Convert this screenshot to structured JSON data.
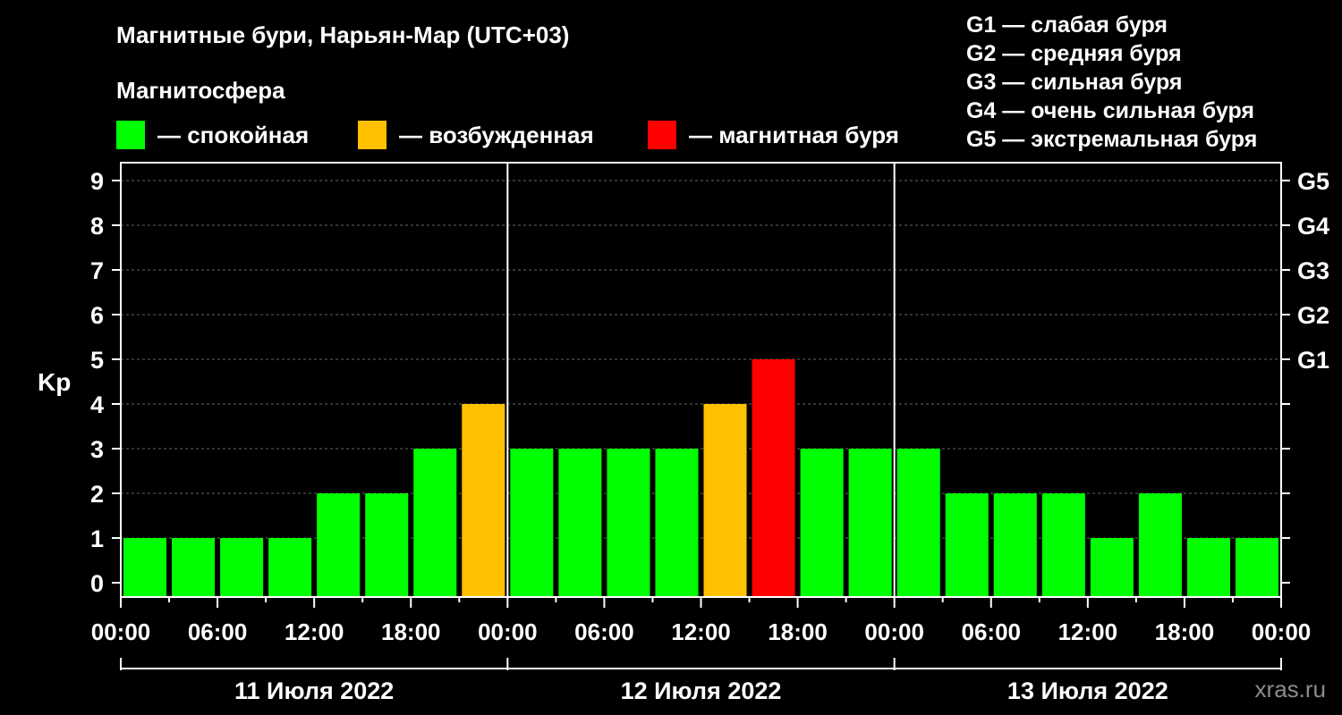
{
  "title": "Магнитные бури, Нарьян-Мар (UTC+03)",
  "legend": {
    "heading": "Магнитосфера",
    "items": [
      {
        "label": "— спокойная",
        "color": "#00ff00"
      },
      {
        "label": "— возбужденная",
        "color": "#ffc000"
      },
      {
        "label": "— магнитная буря",
        "color": "#ff0000"
      }
    ]
  },
  "storm_levels": [
    "G1 — слабая буря",
    "G2 — средняя буря",
    "G3 — сильная буря",
    "G4 — очень сильная буря",
    "G5 — экстремальная буря"
  ],
  "watermark": "xras.ru",
  "chart_data": {
    "type": "bar",
    "ylabel": "Kp",
    "ylim": [
      0,
      9
    ],
    "y_ticks": [
      "0",
      "1",
      "2",
      "3",
      "4",
      "5",
      "6",
      "7",
      "8",
      "9"
    ],
    "g_ticks": [
      {
        "label": "G1",
        "kp": 5
      },
      {
        "label": "G2",
        "kp": 6
      },
      {
        "label": "G3",
        "kp": 7
      },
      {
        "label": "G4",
        "kp": 8
      },
      {
        "label": "G5",
        "kp": 9
      }
    ],
    "x_tick_labels": [
      "00:00",
      "06:00",
      "12:00",
      "18:00",
      "00:00",
      "06:00",
      "12:00",
      "18:00",
      "00:00",
      "06:00",
      "12:00",
      "18:00",
      "00:00"
    ],
    "days": [
      "11 Июля 2022",
      "12 Июля 2022",
      "13 Июля 2022"
    ],
    "values": [
      1,
      1,
      1,
      1,
      2,
      2,
      3,
      4,
      3,
      3,
      3,
      3,
      4,
      5,
      3,
      3,
      3,
      2,
      2,
      2,
      1,
      2,
      1,
      1
    ],
    "colors": [
      "#00ff00",
      "#00ff00",
      "#00ff00",
      "#00ff00",
      "#00ff00",
      "#00ff00",
      "#00ff00",
      "#ffc000",
      "#00ff00",
      "#00ff00",
      "#00ff00",
      "#00ff00",
      "#ffc000",
      "#ff0000",
      "#00ff00",
      "#00ff00",
      "#00ff00",
      "#00ff00",
      "#00ff00",
      "#00ff00",
      "#00ff00",
      "#00ff00",
      "#00ff00",
      "#00ff00"
    ],
    "grid": "dashed horizontal"
  }
}
